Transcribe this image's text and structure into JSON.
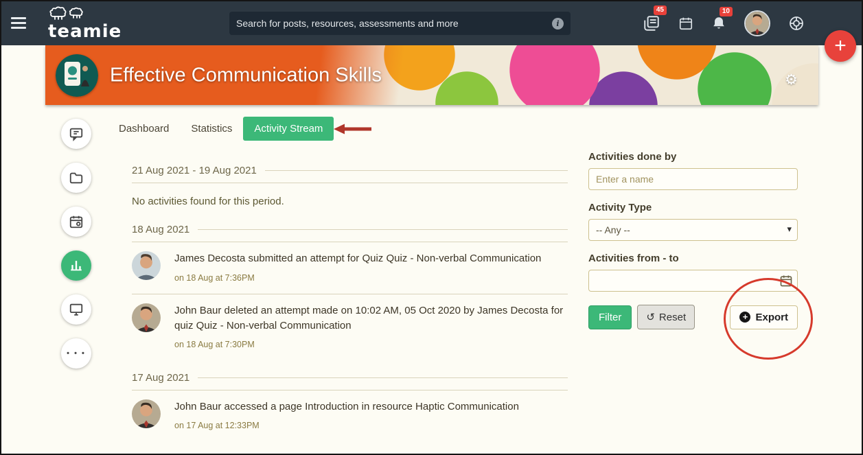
{
  "topbar": {
    "logo_text": "teamie",
    "search_placeholder": "Search for posts, resources, assessments and more",
    "posts_badge": "45",
    "notifications_badge": "10"
  },
  "banner": {
    "title": "Effective Communication Skills"
  },
  "tabs": [
    {
      "label": "Dashboard",
      "active": false
    },
    {
      "label": "Statistics",
      "active": false
    },
    {
      "label": "Activity Stream",
      "active": true
    }
  ],
  "stream": {
    "groups": [
      {
        "date": "21 Aug 2021 - 19 Aug 2021",
        "empty_text": "No activities found for this period.",
        "items": []
      },
      {
        "date": "18 Aug 2021",
        "items": [
          {
            "text": "James Decosta submitted an attempt for Quiz Quiz - Non-verbal Communication",
            "time": "on 18 Aug at 7:36PM"
          },
          {
            "text": "John Baur deleted an attempt made on 10:02 AM, 05 Oct 2020 by James Decosta for quiz Quiz - Non-verbal Communication",
            "time": "on 18 Aug at 7:30PM"
          }
        ]
      },
      {
        "date": "17 Aug 2021",
        "items": [
          {
            "text": "John Baur accessed a page Introduction in resource Haptic Communication",
            "time": "on 17 Aug at 12:33PM"
          }
        ]
      }
    ]
  },
  "filters": {
    "done_by_label": "Activities done by",
    "done_by_placeholder": "Enter a name",
    "type_label": "Activity Type",
    "type_value": "-- Any --",
    "range_label": "Activities from - to",
    "filter_button": "Filter",
    "reset_button": "Reset",
    "export_button": "Export"
  },
  "icons": {
    "plus": "+",
    "gear": "⚙",
    "info": "i",
    "caret": "▾",
    "reset_arrow": "↺",
    "ellipsis": "• • •"
  },
  "colors": {
    "topbar": "#2d3842",
    "accent_green": "#3cb878",
    "badge_red": "#e8413a",
    "annotation_red": "#d63a2c"
  }
}
